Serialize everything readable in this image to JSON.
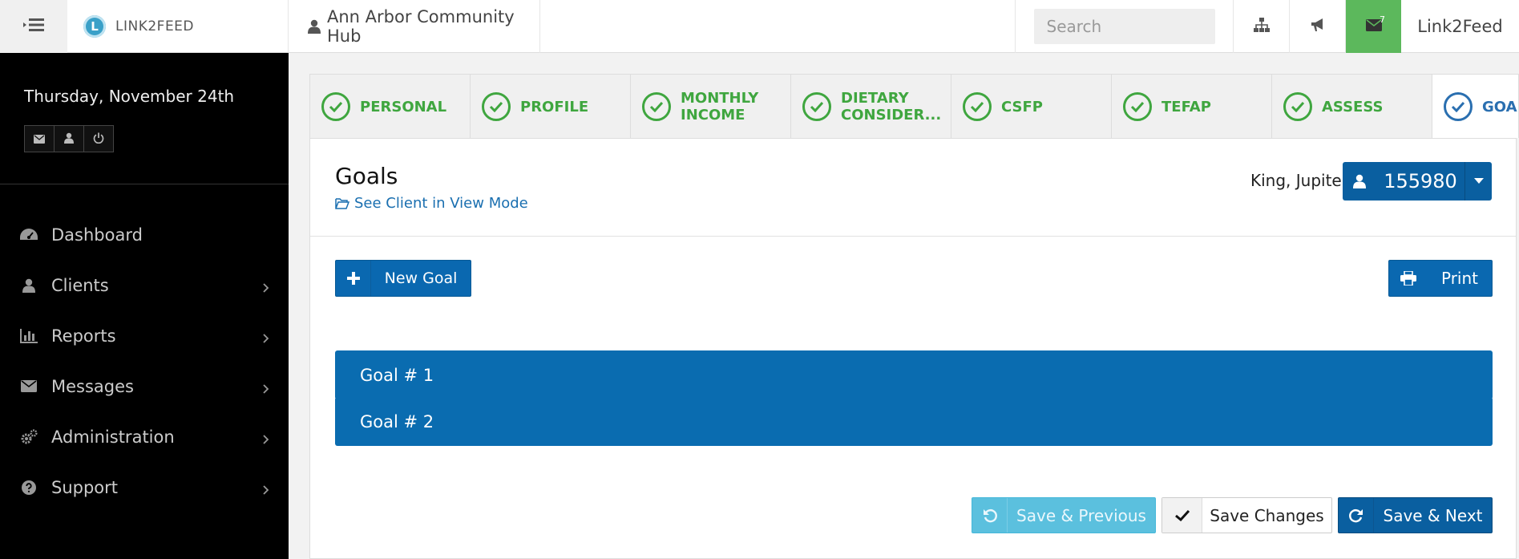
{
  "topbar": {
    "toggle_icon": "menu-collapse-icon",
    "logo_text": "LINK2FEED",
    "org_name": "Ann Arbor Community Hub",
    "search_placeholder": "Search",
    "sitemap_icon": "sitemap-icon",
    "announce_icon": "bullhorn-icon",
    "messages_icon": "envelope-icon",
    "messages_count": "7",
    "user_name": "Link2Feed",
    "messages_bg": "#5cb85c"
  },
  "sidebar": {
    "date": "Thursday, November 24th",
    "quick_buttons": [
      "envelope-icon",
      "user-icon",
      "power-icon"
    ],
    "items": [
      {
        "label": "Dashboard",
        "icon": "dashboard-icon",
        "has_children": false
      },
      {
        "label": "Clients",
        "icon": "user-icon",
        "has_children": true
      },
      {
        "label": "Reports",
        "icon": "bar-chart-icon",
        "has_children": true
      },
      {
        "label": "Messages",
        "icon": "envelope-icon",
        "has_children": true
      },
      {
        "label": "Administration",
        "icon": "cogs-icon",
        "has_children": true
      },
      {
        "label": "Support",
        "icon": "question-circle-icon",
        "has_children": true
      }
    ]
  },
  "tabs": [
    {
      "label": "PERSONAL",
      "state": "complete"
    },
    {
      "label": "PROFILE",
      "state": "complete"
    },
    {
      "label": "MONTHLY\nINCOME",
      "state": "complete"
    },
    {
      "label": "DIETARY\nCONSIDER...",
      "state": "complete"
    },
    {
      "label": "CSFP",
      "state": "complete"
    },
    {
      "label": "TEFAP",
      "state": "complete"
    },
    {
      "label": "ASSESS",
      "state": "complete"
    },
    {
      "label": "GOA",
      "state": "active"
    }
  ],
  "page": {
    "title": "Goals",
    "view_link": "See Client in View Mode",
    "client_name": "King, Jupiter",
    "client_id": "155980",
    "new_goal_label": "New Goal",
    "print_label": "Print",
    "goals": [
      "Goal # 1",
      "Goal # 2"
    ],
    "save_previous_label": "Save & Previous",
    "save_changes_label": "Save Changes",
    "save_next_label": "Save & Next"
  },
  "colors": {
    "primary": "#0a6cb0",
    "success": "#3fa63f",
    "info": "#5bc0de",
    "sidebar_bg": "#000000"
  }
}
